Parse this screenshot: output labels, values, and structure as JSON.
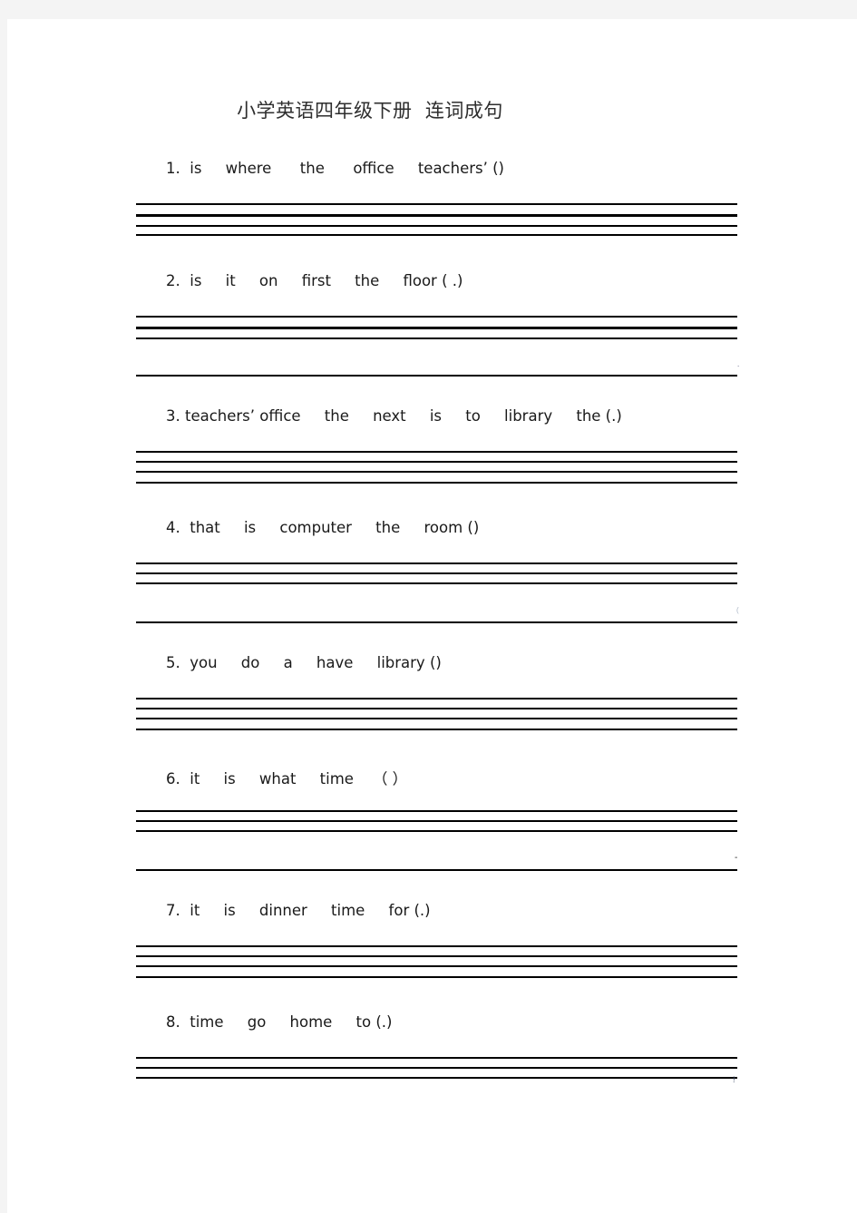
{
  "page": {
    "background_color": "#f4f4f4",
    "paper_color": "#ffffff",
    "title": "小学英语四年级下册  连词成句",
    "rule_color": "#000000",
    "text_color": "#1a1a1a",
    "title_color": "#2e2e2e"
  },
  "worksheet": {
    "subject": "小学英语四年级下册",
    "exercise_type": "连词成句",
    "questions": [
      {
        "number": "1.",
        "text": "1.  is     where      the      office     teachers’ ()",
        "words": [
          "is",
          "where",
          "the",
          "office",
          "teachers’"
        ],
        "punctuation": "()",
        "rule_lines": 4,
        "gap_before_last": false
      },
      {
        "number": "2.",
        "text": "2.  is     it     on     first     the     floor ( .)",
        "words": [
          "is",
          "it",
          "on",
          "first",
          "the",
          "floor"
        ],
        "punctuation": "( .)",
        "rule_lines": 4,
        "gap_before_last": true,
        "speck": "."
      },
      {
        "number": "3.",
        "text": "3. teachers’ office     the     next     is     to     library     the (.)",
        "words": [
          "teachers’",
          "office",
          "the",
          "next",
          "is",
          "to",
          "library",
          "the"
        ],
        "punctuation": "(.)",
        "rule_lines": 4,
        "gap_before_last": false
      },
      {
        "number": "4.",
        "text": "4.  that     is     computer     the     room ()",
        "words": [
          "that",
          "is",
          "computer",
          "the",
          "room"
        ],
        "punctuation": "()",
        "rule_lines": 4,
        "gap_before_last": true,
        "speck": "("
      },
      {
        "number": "5.",
        "text": "5.  you     do     a     have     library ()",
        "words": [
          "you",
          "do",
          "a",
          "have",
          "library"
        ],
        "punctuation": "()",
        "rule_lines": 4,
        "gap_before_last": false
      },
      {
        "number": "6.",
        "text": "6.  it     is     what     time    （ ）",
        "words": [
          "it",
          "is",
          "what",
          "time"
        ],
        "punctuation": "（ ）",
        "rule_lines": 4,
        "gap_before_last": true,
        "speck": "-"
      },
      {
        "number": "7.",
        "text": "7.  it     is     dinner     time     for (.)",
        "words": [
          "it",
          "is",
          "dinner",
          "time",
          "for"
        ],
        "punctuation": "(.)",
        "rule_lines": 4,
        "gap_before_last": false
      },
      {
        "number": "8.",
        "text": "8.  time     go     home     to (.)",
        "words": [
          "time",
          "go",
          "home",
          "to"
        ],
        "punctuation": "(.)",
        "rule_lines": 3,
        "gap_before_last": false,
        "speck": "!"
      }
    ]
  },
  "artifacts": {
    "bottom_right_mark": "!"
  }
}
